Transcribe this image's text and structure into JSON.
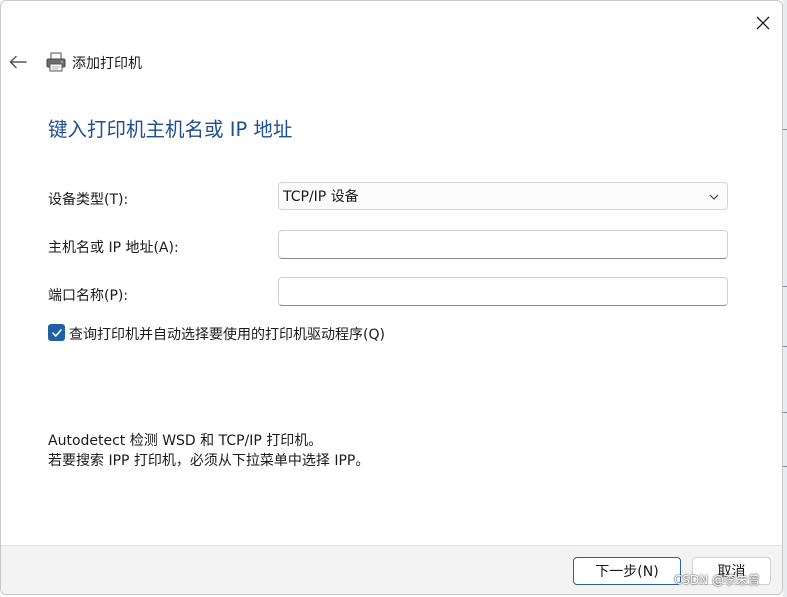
{
  "window": {
    "title": "添加打印机",
    "heading": "键入打印机主机名或 IP 地址"
  },
  "form": {
    "device_type_label": "设备类型(T):",
    "device_type_value": "TCP/IP 设备",
    "hostname_label": "主机名或 IP 地址(A):",
    "hostname_value": "",
    "port_label": "端口名称(P):",
    "port_value": "",
    "auto_select_label": "查询打印机并自动选择要使用的打印机驱动程序(Q)",
    "auto_select_checked": true
  },
  "info": {
    "line1": "Autodetect 检测 WSD 和 TCP/IP 打印机。",
    "line2": "若要搜索 IPP 打印机，必须从下拉菜单中选择 IPP。"
  },
  "buttons": {
    "next_label": "下一步(N)",
    "cancel_label": "取消"
  },
  "watermark": "CSDN @李未曾",
  "icons": {
    "close": "close-icon",
    "back": "back-arrow-icon",
    "printer": "printer-icon",
    "chevron": "chevron-down-icon",
    "check": "checkmark-icon"
  },
  "colors": {
    "heading": "#1d4f91",
    "accent": "#1f5fa6",
    "footer_bg": "#f3f3f3"
  }
}
